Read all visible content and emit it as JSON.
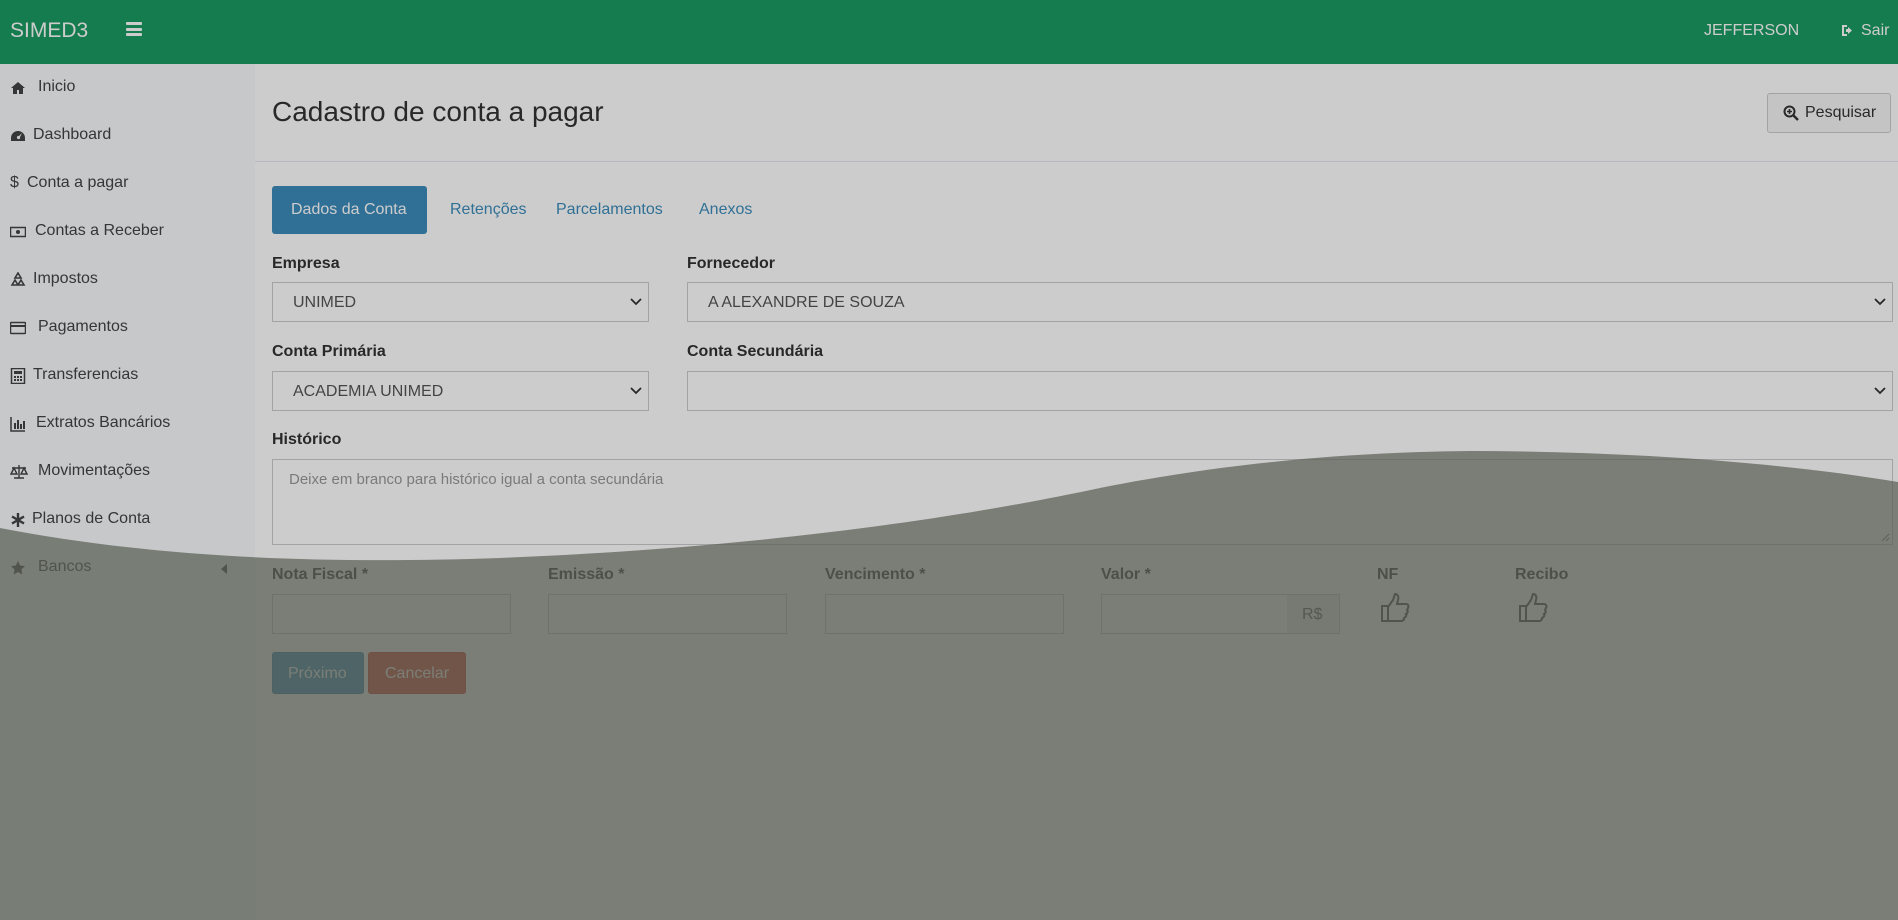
{
  "app": {
    "brand": "SIMED3",
    "user": "JEFFERSON",
    "logout_label": "Sair"
  },
  "sidebar": {
    "items": [
      {
        "label": "Inicio",
        "icon": "home-icon"
      },
      {
        "label": "Dashboard",
        "icon": "dashboard-icon"
      },
      {
        "label": "Conta a pagar",
        "icon": "dollar-icon"
      },
      {
        "label": "Contas a Receber",
        "icon": "money-icon"
      },
      {
        "label": "Impostos",
        "icon": "recycle-icon"
      },
      {
        "label": "Pagamentos",
        "icon": "credit-card-icon"
      },
      {
        "label": "Transferencias",
        "icon": "calculator-icon"
      },
      {
        "label": "Extratos Bancários",
        "icon": "bar-chart-icon"
      },
      {
        "label": "Movimentações",
        "icon": "balance-scale-icon"
      },
      {
        "label": "Planos de Conta",
        "icon": "asterisk-icon"
      },
      {
        "label": "Bancos",
        "icon": "star-icon"
      }
    ]
  },
  "header": {
    "title": "Cadastro de conta a pagar",
    "search_label": "Pesquisar"
  },
  "tabs": [
    {
      "label": "Dados da Conta",
      "active": true
    },
    {
      "label": "Retenções",
      "active": false
    },
    {
      "label": "Parcelamentos",
      "active": false
    },
    {
      "label": "Anexos",
      "active": false
    }
  ],
  "form": {
    "empresa": {
      "label": "Empresa",
      "value": "UNIMED"
    },
    "fornecedor": {
      "label": "Fornecedor",
      "value": "A ALEXANDRE DE SOUZA"
    },
    "conta_primaria": {
      "label": "Conta Primária",
      "value": "ACADEMIA UNIMED"
    },
    "conta_secundaria": {
      "label": "Conta Secundária",
      "value": ""
    },
    "historico": {
      "label": "Histórico",
      "placeholder": "Deixe em branco para histórico igual a conta secundária"
    },
    "nota_fiscal": {
      "label": "Nota Fiscal",
      "value": ""
    },
    "emissao": {
      "label": "Emissão",
      "value": ""
    },
    "vencimento": {
      "label": "Vencimento",
      "value": ""
    },
    "valor": {
      "label": "Valor",
      "value": "",
      "addon": "R$"
    },
    "required_mark": "*",
    "nf": {
      "label": "NF",
      "icon": "thumbs-up-icon"
    },
    "recibo": {
      "label": "Recibo",
      "icon": "thumbs-up-icon"
    }
  },
  "buttons": {
    "next": "Próximo",
    "cancel": "Cancelar"
  },
  "colors": {
    "topbar": "#1a9c62",
    "primary": "#3c8dbc",
    "danger": "#dd4b39",
    "overlay": "#5a5f55"
  }
}
